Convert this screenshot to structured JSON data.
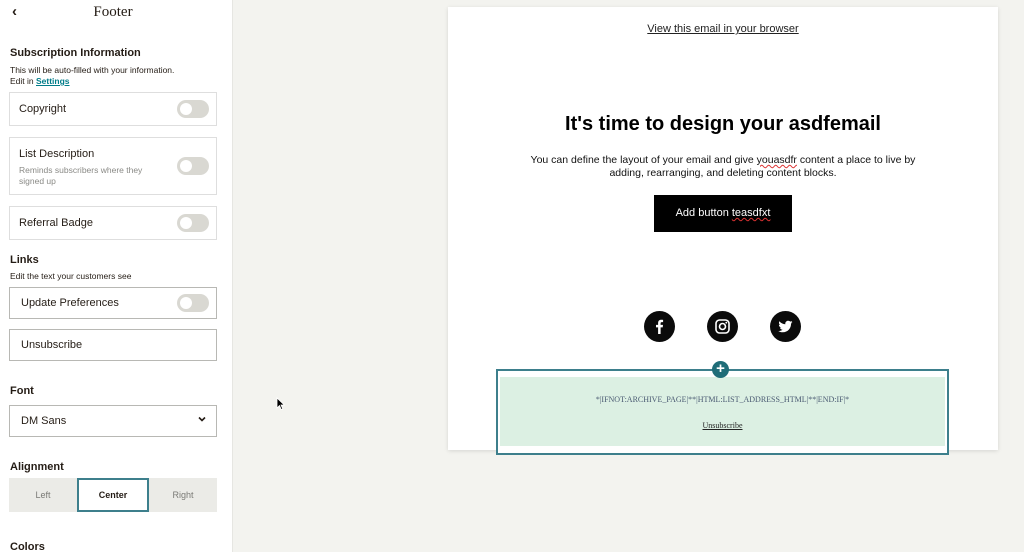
{
  "panel": {
    "back_icon": "‹",
    "title": "Footer"
  },
  "subscription": {
    "title": "Subscription Information",
    "desc_line1": "This will be auto-filled with your information.",
    "desc_prefix": "Edit in ",
    "settings_link": "Settings",
    "items": [
      {
        "label": "Copyright",
        "enabled": false
      },
      {
        "label": "List Description",
        "sublabel": "Reminds subscribers where they signed up",
        "enabled": false
      },
      {
        "label": "Referral Badge",
        "enabled": false
      }
    ]
  },
  "links": {
    "title": "Links",
    "desc": "Edit the text your customers see",
    "update_preferences": {
      "label": "Update Preferences",
      "enabled": false
    },
    "unsubscribe": {
      "label": "Unsubscribe"
    }
  },
  "font": {
    "title": "Font",
    "selected": "DM Sans",
    "chevron": "⌄"
  },
  "alignment": {
    "title": "Alignment",
    "options": [
      "Left",
      "Center",
      "Right"
    ],
    "selected": "Center"
  },
  "colors": {
    "title": "Colors"
  },
  "email": {
    "view_in_browser": "View this email in your browser",
    "headline": "It's time to design your asdfemail",
    "body_part1": "You can define the layout of your email and give ",
    "body_misspelled": "youasdfr",
    "body_part2": " content a place to live by adding, rearranging, and deleting content blocks.",
    "button_part1": "Add button ",
    "button_misspelled": "teasdfxt",
    "socials": [
      "facebook",
      "instagram",
      "twitter"
    ],
    "footer_merge_tags": "*|IFNOT:ARCHIVE_PAGE|**|HTML:LIST_ADDRESS_HTML|**|END:IF|*",
    "footer_unsubscribe": "Unsubscribe",
    "add_block_icon": "+"
  },
  "theme": {
    "accent": "#007c89",
    "selection_border": "#3d7f8c",
    "footer_bg": "#dcf0e3",
    "canvas_bg": "#f3f3ef"
  }
}
